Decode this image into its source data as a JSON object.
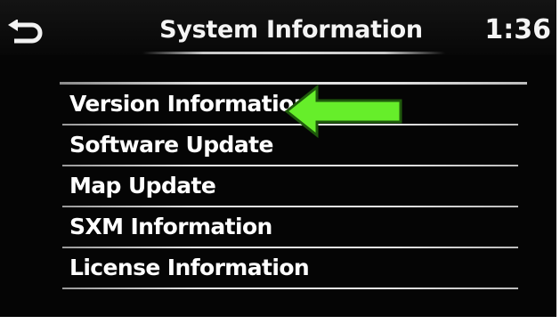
{
  "header": {
    "title": "System Information",
    "clock": "1:36",
    "back_icon": "back-arrow-icon"
  },
  "menu": {
    "items": [
      {
        "label": "Version Information"
      },
      {
        "label": "Software Update"
      },
      {
        "label": "Map Update"
      },
      {
        "label": "SXM Information"
      },
      {
        "label": "License Information"
      }
    ]
  },
  "annotation": {
    "icon": "arrow-left-icon",
    "color": "#66ee2a",
    "outline_color": "#1f5a0c"
  }
}
